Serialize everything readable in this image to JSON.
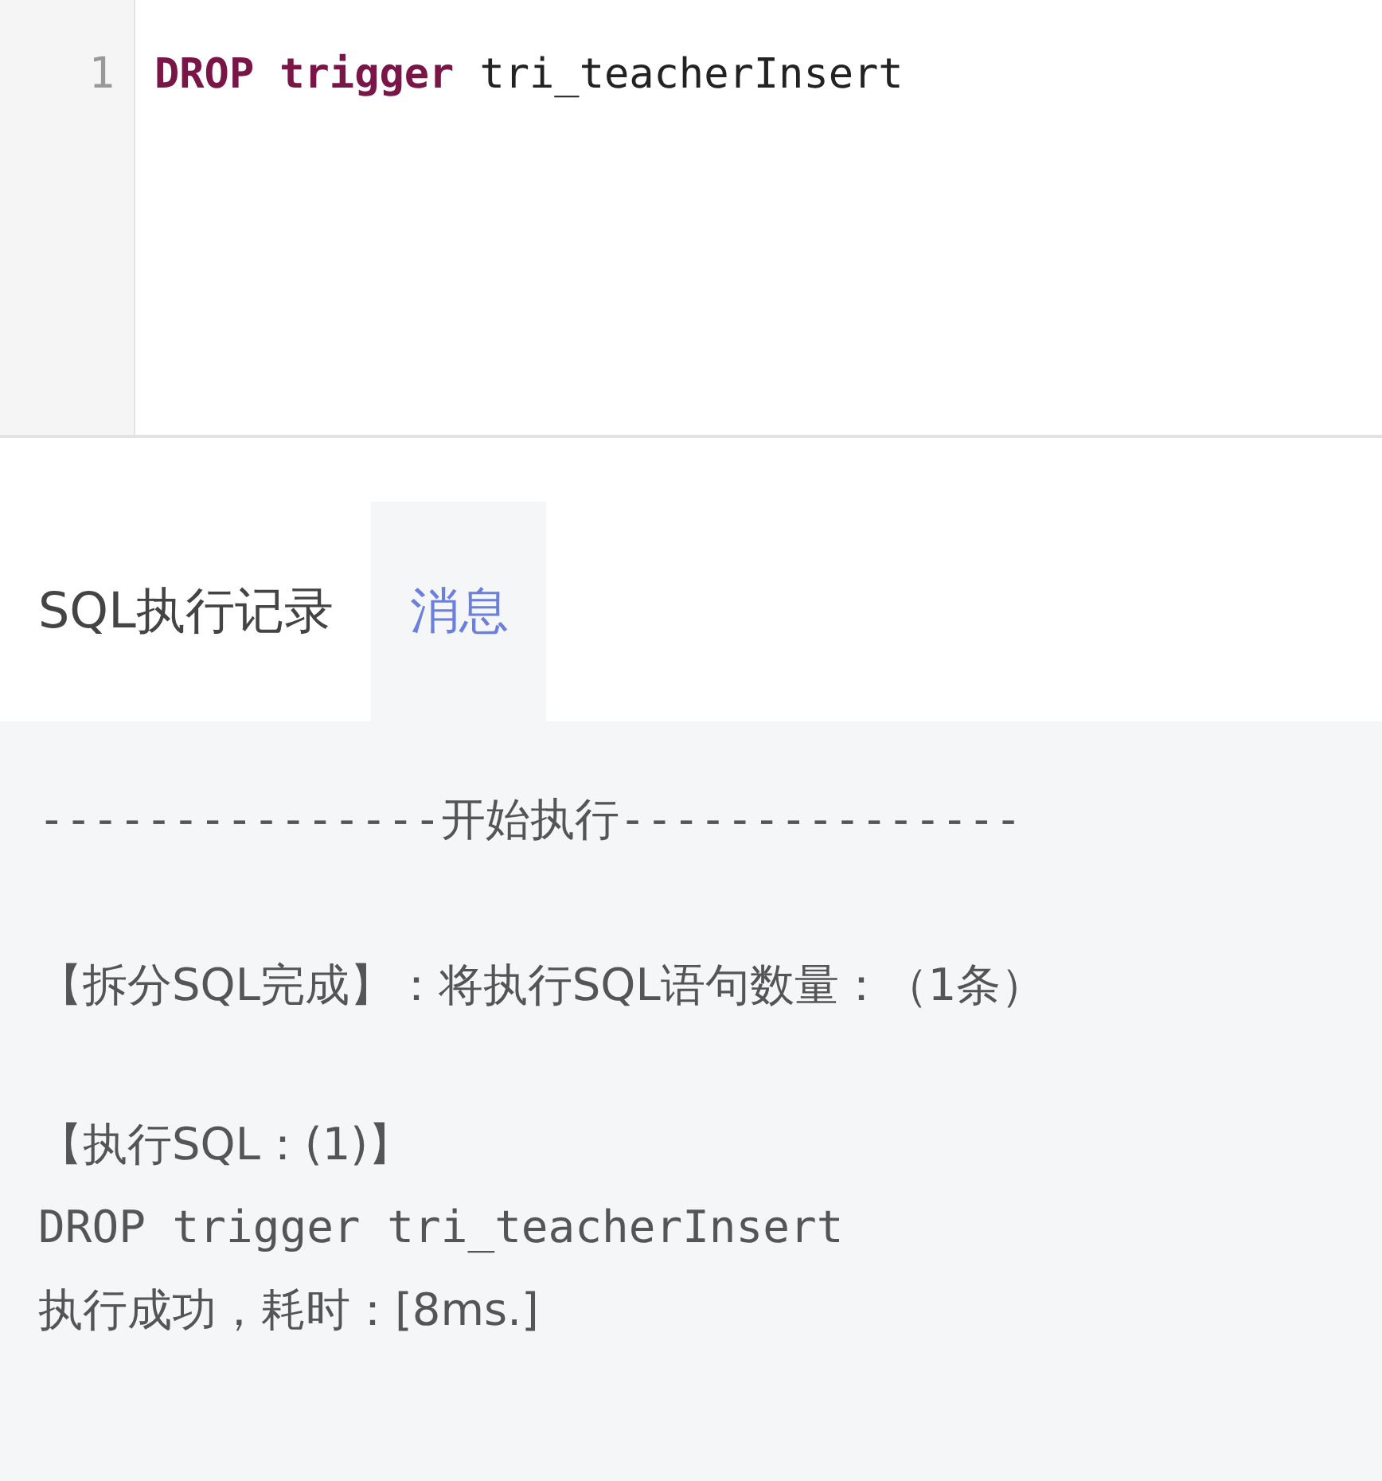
{
  "editor": {
    "lines": [
      {
        "number": "1",
        "tokens": [
          {
            "kind": "keyword",
            "text": "DROP"
          },
          {
            "kind": "keyword",
            "text": "trigger"
          },
          {
            "kind": "plain",
            "text": "tri_teacherInsert"
          }
        ]
      }
    ]
  },
  "tabs": [
    {
      "label": "SQL执行记录",
      "selected": false
    },
    {
      "label": "消息",
      "selected": true
    }
  ],
  "log": [
    {
      "kind": "banner",
      "text": "---------------开始执行---------------"
    },
    {
      "kind": "notice",
      "text": "【拆分SQL完成】：将执行SQL语句数量：（1条）"
    },
    {
      "kind": "step",
      "text": "【执行SQL：(1)】"
    },
    {
      "kind": "statement",
      "text": "DROP trigger tri_teacherInsert"
    },
    {
      "kind": "result",
      "text": "执行成功，耗时：[8ms.]"
    }
  ]
}
